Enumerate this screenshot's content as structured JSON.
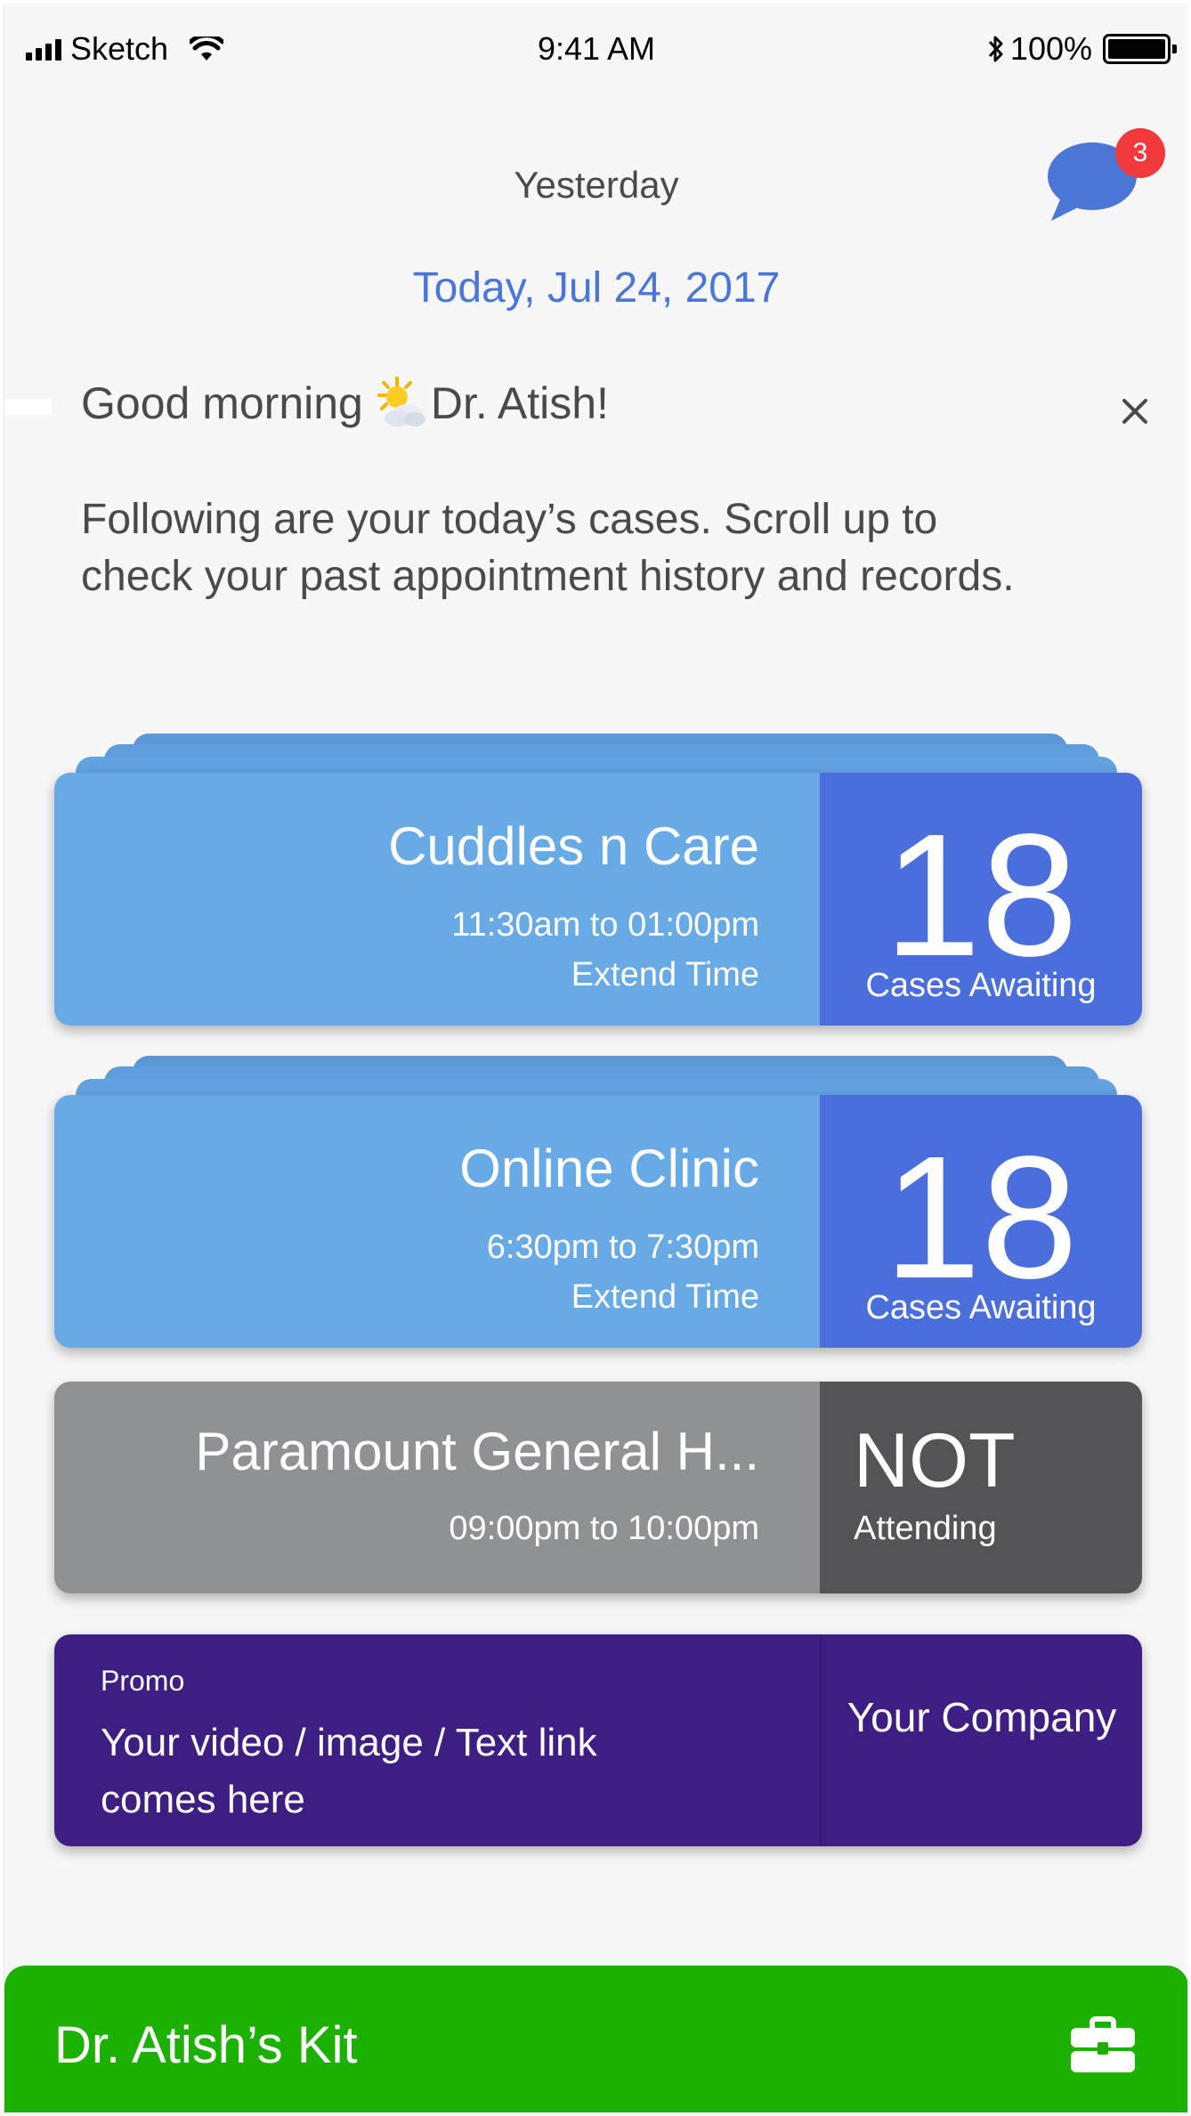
{
  "status_bar": {
    "carrier": "Sketch",
    "time": "9:41 AM",
    "battery_percent": "100%",
    "icons": [
      "signal-bars-icon",
      "wifi-icon",
      "bluetooth-icon",
      "battery-icon"
    ]
  },
  "header": {
    "previous_day": "Yesterday",
    "current_date": "Today, Jul 24, 2017",
    "messages_badge": "3",
    "date_color": "#4a76d8",
    "badge_color": "#f2393c"
  },
  "greeting": {
    "prefix": "Good morning",
    "weather_icon": "partly-sunny-icon",
    "name": "Dr. Atish!",
    "message": "Following are your today’s cases. Scroll up to check your past appointment history and records."
  },
  "sessions": [
    {
      "name": "Cuddles n Care",
      "time": "11:30am to 01:00pm",
      "action": "Extend Time",
      "count": "18",
      "count_label": "Cases Awaiting",
      "status": "active"
    },
    {
      "name": "Online Clinic",
      "time": "6:30pm to 7:30pm",
      "action": "Extend Time",
      "count": "18",
      "count_label": "Cases Awaiting",
      "status": "active"
    },
    {
      "name": "Paramount General H...",
      "time": "09:00pm to 10:00pm",
      "status_main": "NOT",
      "status_sub": "Attending",
      "status": "not-attending"
    }
  ],
  "promo": {
    "tag": "Promo",
    "text": "Your video / image / Text link comes here",
    "company": "Your Company"
  },
  "kit": {
    "label": "Dr. Atish’s Kit",
    "icon": "briefcase-icon",
    "color": "#1cb100"
  },
  "colors": {
    "card_blue_light": "#67aae6",
    "card_blue_dark": "#4a6fdc",
    "card_grey_light": "#8f9194",
    "card_grey_dark": "#545456",
    "promo_purple": "#3e1e82"
  }
}
